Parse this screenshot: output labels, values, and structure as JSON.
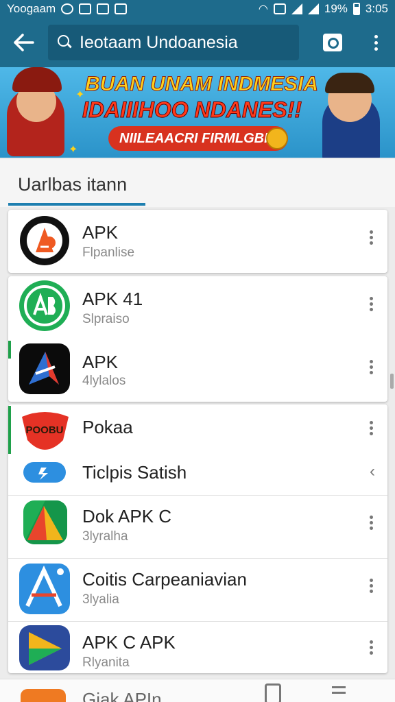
{
  "status_bar": {
    "carrier": "Yoogaam",
    "battery": "19%",
    "time": "3:05"
  },
  "toolbar": {
    "search_query": "Ieotaam Undoanesia"
  },
  "banner": {
    "line1": "BUAN UNAM INDMESIA",
    "line2": "IDAIIIHOO NDANES!!",
    "pill": "NIILEAACRI FIRMLGBI"
  },
  "section": {
    "title": "Uarlbas itann"
  },
  "apps": [
    {
      "name": "APK",
      "sub": "Flpanlise"
    },
    {
      "name": "APK 41",
      "sub": "Slpraiso"
    },
    {
      "name": "APK",
      "sub": "4lylalos"
    },
    {
      "name": "Pokaa",
      "sub": ""
    },
    {
      "name": "Ticlpis Satish",
      "sub": ""
    },
    {
      "name": "Dok  APK C",
      "sub": "3lyralha"
    },
    {
      "name": "Coitis Carpeaniavian",
      "sub": "3lyalia"
    },
    {
      "name": "APK C APK",
      "sub": "Rlyanita"
    }
  ],
  "icon_labels": {
    "poobu": "POOBU"
  },
  "bottom": {
    "label": "Giak  APIn"
  }
}
